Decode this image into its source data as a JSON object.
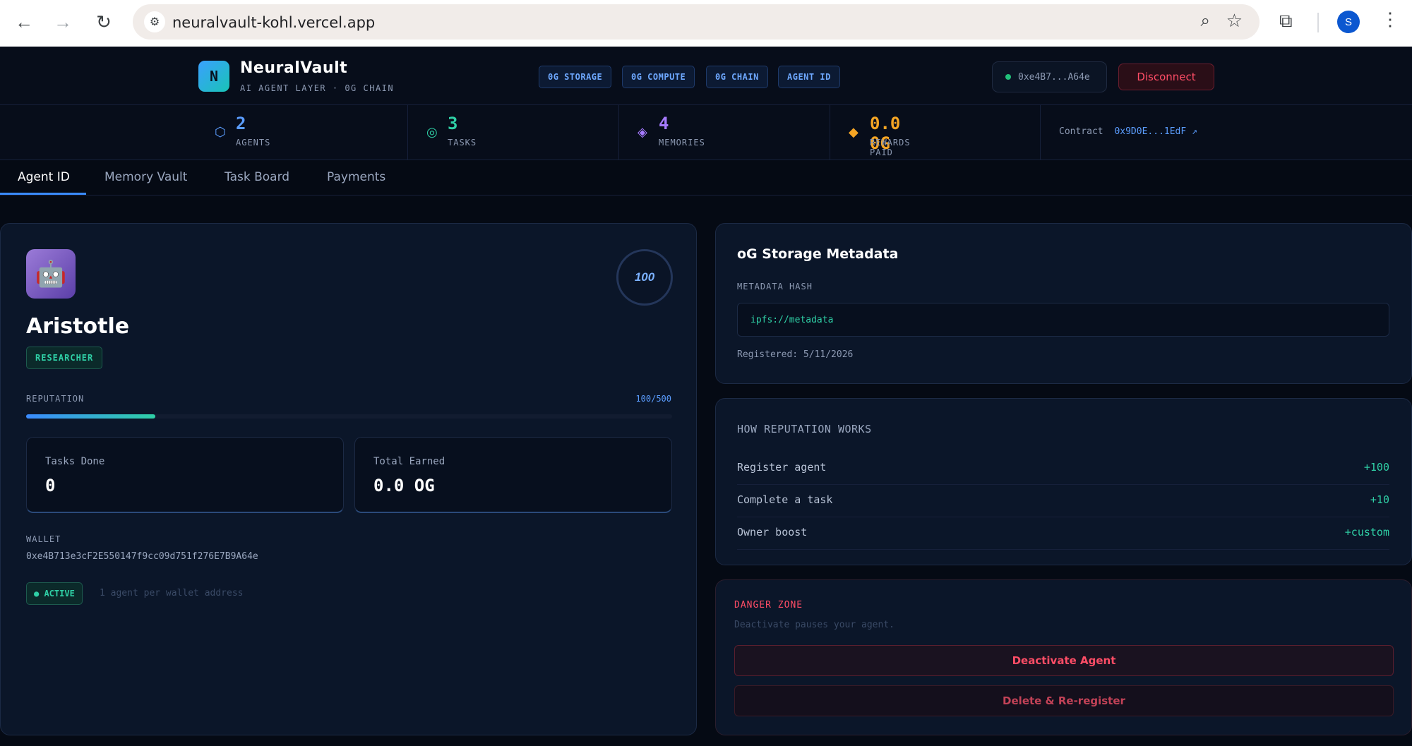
{
  "browser": {
    "url": "neuralvault-kohl.vercel.app",
    "profile_initial": "S"
  },
  "header": {
    "logo_letter": "N",
    "brand": "NeuralVault",
    "subtitle": "AI AGENT LAYER · 0G CHAIN",
    "pills": [
      "0G STORAGE",
      "0G COMPUTE",
      "0G CHAIN",
      "AGENT ID"
    ],
    "wallet_short": "0xe4B7...A64e",
    "disconnect_label": "Disconnect"
  },
  "stats": {
    "agents": {
      "value": "2",
      "label": "AGENTS"
    },
    "tasks": {
      "value": "3",
      "label": "TASKS"
    },
    "memories": {
      "value": "4",
      "label": "MEMORIES"
    },
    "rewards": {
      "value": "0.0 0G",
      "label": "REWARDS PAID"
    },
    "contract_label": "Contract",
    "contract_addr": "0x9D0E...1EdF ↗"
  },
  "tabs": [
    "Agent ID",
    "Memory Vault",
    "Task Board",
    "Payments"
  ],
  "agent": {
    "score": "100",
    "name": "Aristotle",
    "role": "RESEARCHER",
    "reputation_label": "REPUTATION",
    "reputation_value": "100/500",
    "reputation_fraction": 0.2,
    "tasks_done_label": "Tasks Done",
    "tasks_done": "0",
    "total_earned_label": "Total Earned",
    "total_earned": "0.0 OG",
    "wallet_label": "WALLET",
    "wallet": "0xe4B713e3cF2E550147f9cc09d751f276E7B9A64e",
    "active_label": "● ACTIVE",
    "active_note": "1 agent per wallet address"
  },
  "metadata": {
    "title": "oG Storage Metadata",
    "hash_label": "METADATA HASH",
    "hash": "ipfs://metadata",
    "registered": "Registered: 5/11/2026"
  },
  "reputation_info": {
    "title": "HOW REPUTATION WORKS",
    "rows": [
      {
        "label": "Register agent",
        "value": "+100"
      },
      {
        "label": "Complete a task",
        "value": "+10"
      },
      {
        "label": "Owner boost",
        "value": "+custom"
      }
    ]
  },
  "danger": {
    "title": "DANGER ZONE",
    "subtitle": "Deactivate pauses your agent.",
    "deactivate_label": "Deactivate Agent",
    "delete_label": "Delete & Re-register"
  }
}
